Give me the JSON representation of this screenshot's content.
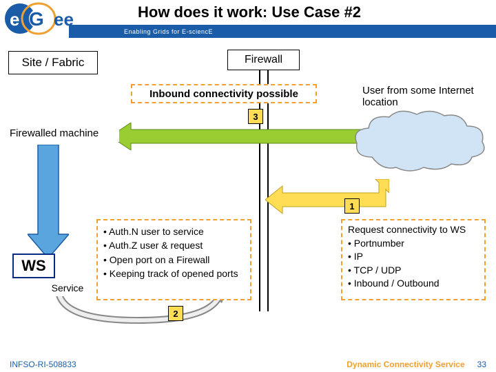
{
  "header": {
    "title": "How does it work: Use Case  #2",
    "subtitle": "Enabling Grids for E-sciencE",
    "logo_text": "eGee"
  },
  "boxes": {
    "site_fabric": "Site / Fabric",
    "firewall": "Firewall",
    "inbound": "Inbound connectivity possible",
    "user_location": "User from some Internet location",
    "firewalled_machine": "Firewalled machine",
    "ws": "WS",
    "service": "Service"
  },
  "service_list": [
    "Auth.N user to service",
    "Auth.Z user & request",
    "Open port on a Firewall",
    "Keeping track of opened ports"
  ],
  "request_list": {
    "title": "Request connectivity to WS",
    "items": [
      "Portnumber",
      "IP",
      "TCP / UDP",
      "Inbound / Outbound"
    ]
  },
  "steps": {
    "s1": "1",
    "s2": "2",
    "s3": "3"
  },
  "footer": {
    "left": "INFSO-RI-508833",
    "right": "Dynamic Connectivity Service",
    "page": "33"
  },
  "colors": {
    "blue": "#1a5ca8",
    "orange": "#f0a030",
    "green": "#9acd32",
    "yellow": "#ffdd55",
    "navy": "#002b80"
  }
}
